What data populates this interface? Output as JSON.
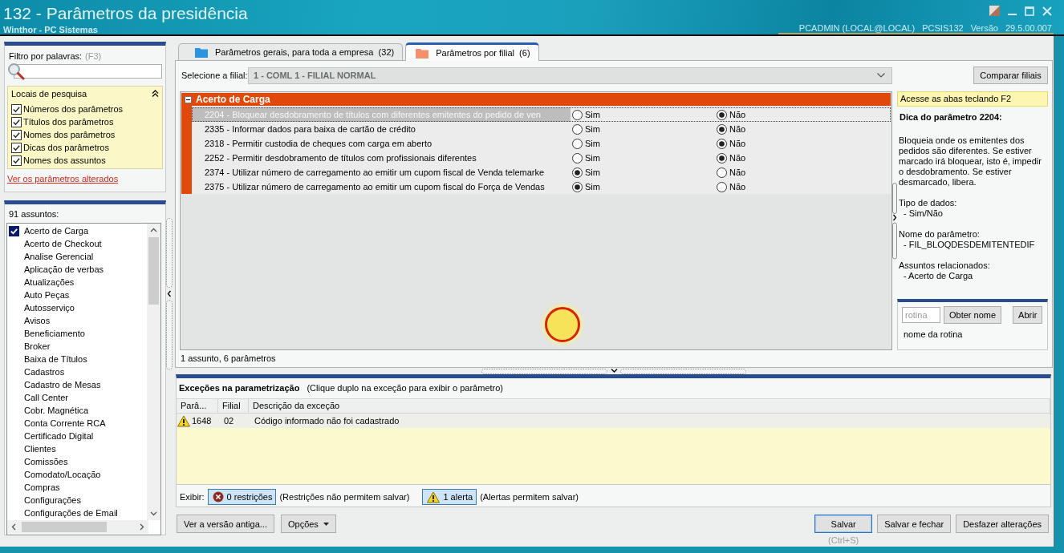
{
  "window": {
    "title": "132 - Parâmetros da presidência",
    "subtitle": "Winthor - PC Sistemas",
    "session": [
      "PCADMIN (LOCAL@LOCAL)",
      "PCSIS132",
      "Versão",
      "29.5.00.007"
    ]
  },
  "filter": {
    "label": "Filtro por palavras:",
    "shortcut": "(F3)",
    "locations": {
      "title": "Locais de pesquisa",
      "expanded": true,
      "options": [
        {
          "label": "Números dos parâmetros",
          "checked": true
        },
        {
          "label": "Títulos dos parâmetros",
          "checked": true
        },
        {
          "label": "Nomes dos parâmetros",
          "checked": true
        },
        {
          "label": "Dicas dos parâmetros",
          "checked": true
        },
        {
          "label": "Nomes dos assuntos",
          "checked": true
        }
      ]
    },
    "changed_link": "Ver os parâmetros alterados"
  },
  "subjects": {
    "count_label": "91 assuntos:",
    "items": [
      {
        "label": "Acerto de Carga",
        "checked": true
      },
      {
        "label": "Acerto de Checkout",
        "checked": false
      },
      {
        "label": "Analise Gerencial",
        "checked": false
      },
      {
        "label": "Aplicação de verbas",
        "checked": false
      },
      {
        "label": "Atualizações",
        "checked": false
      },
      {
        "label": "Auto Peças",
        "checked": false
      },
      {
        "label": "Autosserviço",
        "checked": false
      },
      {
        "label": "Avisos",
        "checked": false
      },
      {
        "label": "Beneficiamento",
        "checked": false
      },
      {
        "label": "Broker",
        "checked": false
      },
      {
        "label": "Baixa de Títulos",
        "checked": false
      },
      {
        "label": "Cadastros",
        "checked": false
      },
      {
        "label": "Cadastro de Mesas",
        "checked": false
      },
      {
        "label": "Call Center",
        "checked": false
      },
      {
        "label": "Cobr. Magnética",
        "checked": false
      },
      {
        "label": "Conta Corrente RCA",
        "checked": false
      },
      {
        "label": "Certificado Digital",
        "checked": false
      },
      {
        "label": "Clientes",
        "checked": false
      },
      {
        "label": "Comissões",
        "checked": false
      },
      {
        "label": "Comodato/Locação",
        "checked": false
      },
      {
        "label": "Compras",
        "checked": false
      },
      {
        "label": "Configurações",
        "checked": false
      },
      {
        "label": "Configurações de Email",
        "checked": false
      }
    ]
  },
  "tabs": [
    {
      "label": "Parâmetros gerais, para toda a empresa  (32)",
      "color": "#2b93e0",
      "selected": false
    },
    {
      "label": "Parâmetros por filial  (6)",
      "color": "#f4916a",
      "selected": true
    }
  ],
  "branch": {
    "label": "Selecione a filial:",
    "value": "1 - COML 1 - FILIAL NORMAL",
    "compare_button": "Comparar filiais"
  },
  "parameter_grid": {
    "group": {
      "title": "Acerto de Carga",
      "expanded": true
    },
    "rows": [
      {
        "text": "2204 - Bloquear desdobramento de títulos com diferentes emitentes do pedido de ven",
        "selected": true,
        "options": [
          {
            "label": "Sim",
            "selected": false
          },
          {
            "label": "Não",
            "selected": true
          }
        ]
      },
      {
        "text": "2335 - Informar dados para baixa de cartão de crédito",
        "selected": false,
        "options": [
          {
            "label": "Sim",
            "selected": false
          },
          {
            "label": "Não",
            "selected": true
          }
        ]
      },
      {
        "text": "2318 - Permitir custodia de cheques com carga em aberto",
        "selected": false,
        "options": [
          {
            "label": "Sim",
            "selected": false
          },
          {
            "label": "Não",
            "selected": true
          }
        ]
      },
      {
        "text": "2252 - Permitir desdobramento de títulos com profissionais diferentes",
        "selected": false,
        "options": [
          {
            "label": "Sim",
            "selected": false
          },
          {
            "label": "Não",
            "selected": true
          }
        ]
      },
      {
        "text": "2374 - Utilizar número de carregamento ao emitir um cupom fiscal de Venda telemarke",
        "selected": false,
        "options": [
          {
            "label": "Sim",
            "selected": true
          },
          {
            "label": "Não",
            "selected": false
          }
        ]
      },
      {
        "text": "2375 - Utilizar número de carregamento ao emitir um cupom fiscal do Força de Vendas",
        "selected": false,
        "options": [
          {
            "label": "Sim",
            "selected": true
          },
          {
            "label": "Não",
            "selected": false
          }
        ]
      }
    ],
    "summary": "1 assunto, 6 parâmetros"
  },
  "hint_panel": {
    "shortcut_tip": "Acesse as abas teclando F2",
    "title": "Dica do parâmetro 2204:",
    "description": "Bloqueia onde os emitentes dos pedidos são diferentes. Se estiver marcado irá bloquear, isto é, impedir o desdobramento. Se estiver desmarcado, libera.",
    "sections": [
      {
        "heading": "Tipo de dados:",
        "value": "- Sim/Não"
      },
      {
        "heading": "Nome do parâmetro:",
        "value": "- FIL_BLOQDESDEMITENTEDIF"
      },
      {
        "heading": "Assuntos relacionados:",
        "value": "- Acerto de Carga"
      }
    ]
  },
  "routine_lookup": {
    "placeholder": "rotina",
    "buttons": [
      "Obter nome",
      "Abrir"
    ],
    "result": "nome da rotina"
  },
  "exceptions": {
    "title": "Exceções na parametrização",
    "hint": "(Clique duplo na exceção para exibir o parâmetro)",
    "columns": [
      "Parâ...",
      "Filial",
      "Descrição da exceção"
    ],
    "rows": [
      {
        "kind": "alert",
        "cells": [
          "1648",
          "02",
          "Código informado não foi cadastrado"
        ]
      }
    ],
    "filter_label": "Exibir:",
    "filters": [
      {
        "kind": "restriction",
        "label": "0 restrições",
        "note": "(Restrições não permitem salvar)",
        "selected": true
      },
      {
        "kind": "alert",
        "label": "1 alerta",
        "note": "(Alertas permitem salvar)",
        "selected": true
      }
    ]
  },
  "footer": {
    "left_buttons": [
      {
        "kind": "plain",
        "label": "Ver a versão antiga..."
      },
      {
        "kind": "menu",
        "label": "Opções"
      }
    ],
    "right_buttons": [
      {
        "label": "Salvar",
        "shortcut": "(Ctrl+S)",
        "focused": true
      },
      {
        "label": "Salvar e fechar",
        "focused": false
      },
      {
        "label": "Desfazer alterações",
        "focused": false
      }
    ]
  }
}
